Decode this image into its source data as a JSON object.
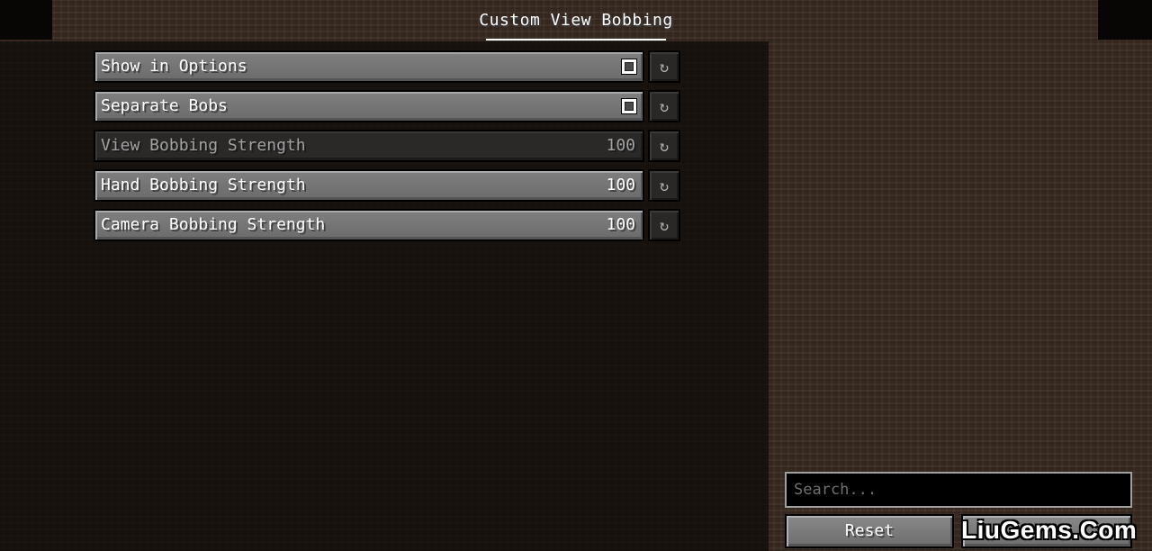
{
  "screen": {
    "title": "Custom View Bobbing"
  },
  "options": [
    {
      "label": "Show in Options",
      "value": "",
      "type": "checkbox",
      "checked": true,
      "enabled": true
    },
    {
      "label": "Separate Bobs",
      "value": "",
      "type": "checkbox",
      "checked": true,
      "enabled": true
    },
    {
      "label": "View Bobbing Strength",
      "value": "100",
      "type": "slider",
      "enabled": false
    },
    {
      "label": "Hand Bobbing Strength",
      "value": "100",
      "type": "slider",
      "enabled": true
    },
    {
      "label": "Camera Bobbing Strength",
      "value": "100",
      "type": "slider",
      "enabled": true
    }
  ],
  "reset_icon_glyph": "↻",
  "search": {
    "placeholder": "Search..."
  },
  "buttons": {
    "reset_label": "Reset",
    "done_label": ""
  },
  "watermark": {
    "text": "LiuGems.Com"
  },
  "colors": {
    "background_dirt": "#3b2c23",
    "button_gray": "#7a7a7a",
    "panel_dark": "#0e0b09"
  }
}
